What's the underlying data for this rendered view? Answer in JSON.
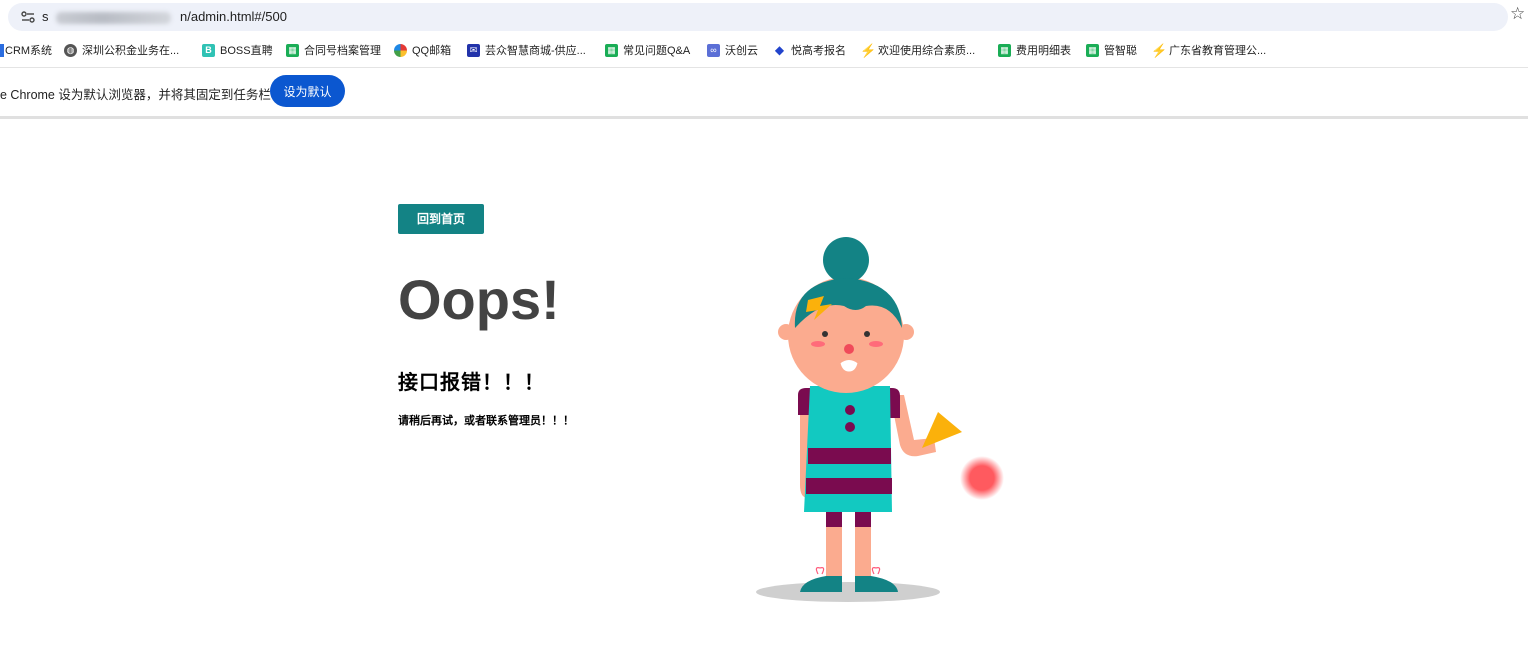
{
  "browser": {
    "url_prefix": "s",
    "url_suffix": "n/admin.html#/500",
    "bookmarks": [
      {
        "label": "CRM系统",
        "icon": "crm-icon"
      },
      {
        "label": "深圳公积金业务在...",
        "icon": "globe-icon"
      },
      {
        "label": "BOSS直聘",
        "icon": "boss-icon",
        "glyph": "B"
      },
      {
        "label": "合同号档案管理",
        "icon": "sheet-icon"
      },
      {
        "label": "QQ邮箱",
        "icon": "qq-mail-icon"
      },
      {
        "label": "芸众智慧商城-供应...",
        "icon": "yunzhong-icon"
      },
      {
        "label": "常见问题Q&A",
        "icon": "sheet-icon"
      },
      {
        "label": "沃创云",
        "icon": "wochuang-icon"
      },
      {
        "label": "悦高考报名",
        "icon": "diamond-icon"
      },
      {
        "label": "欢迎使用综合素质...",
        "icon": "runner-icon"
      },
      {
        "label": "费用明细表",
        "icon": "sheet-icon"
      },
      {
        "label": "管智聪",
        "icon": "sheet-icon"
      },
      {
        "label": "广东省教育管理公...",
        "icon": "runner-icon"
      }
    ]
  },
  "default_banner": {
    "text": "e Chrome 设为默认浏览器，并将其固定到任务栏",
    "button_label": "设为默认"
  },
  "error_page": {
    "home_button_label": "回到首页",
    "title": "Oops!",
    "headline": "接口报错！！！",
    "subline": "请稍后再试，或者联系管理员！！！"
  },
  "colors": {
    "teal": "#138385",
    "dress": "#12c9c1",
    "stripe": "#7a0b4f",
    "skin": "#fbab8f",
    "flag": "#fbb10b",
    "ball": "#ff5a5f",
    "banner_button": "#0b57d0"
  }
}
